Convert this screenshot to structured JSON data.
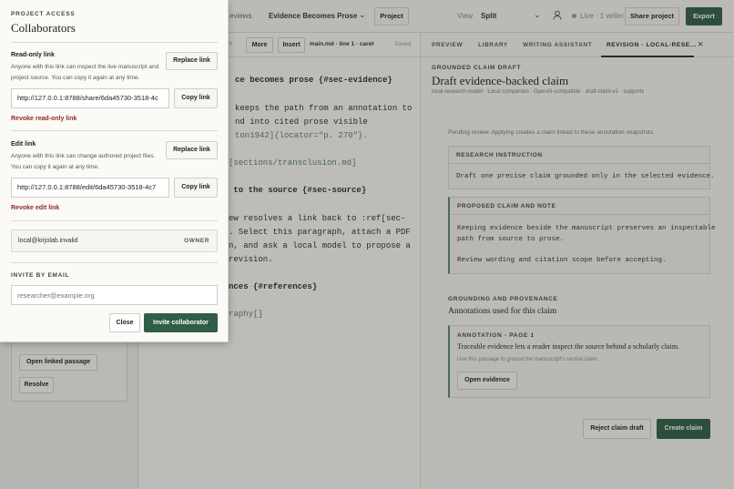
{
  "topbar": {
    "nav_label": "eviews",
    "document_title": "Evidence Becomes Prose",
    "project_button": "Project",
    "view_label": "View",
    "view_value": "Split",
    "live_status": "Live · 1 writer",
    "share_button": "Share project",
    "export_button": "Export"
  },
  "left": {
    "open_linked_passage": "Open linked passage",
    "resolve": "Resolve"
  },
  "editor": {
    "toolbar": {
      "item_partial": "in",
      "more": "More",
      "insert": "Insert",
      "file_status": "main.md · line 1 · caret",
      "saved": "Saved"
    },
    "lines": [
      "ce becomes prose {#sec-evidence}",
      "keeps the path from an annotation to",
      "nd into cited prose visible",
      "ton1942]{locator=\"p. 270\"}.",
      "[sections/transclusion.md]",
      " to the source {#sec-source}",
      "ew resolves a link back to :ref[sec-",
      ". Select this paragraph, attach a PDF",
      "n, and ask a local model to propose a",
      "revision.",
      "nces {#references}",
      "raphy[]"
    ]
  },
  "right": {
    "tabs": [
      "PREVIEW",
      "LIBRARY",
      "WRITING ASSISTANT",
      "REVISION - LOCAL-RESE..."
    ],
    "eyebrow": "GROUNDED CLAIM DRAFT",
    "title": "Draft evidence-backed claim",
    "meta": "local-research-model · Local companion · OpenAI-compatible · draft-claim-v1 · supports",
    "pending": "Pending review. Applying creates a claim linked to these annotation snapshots.",
    "instruction_header": "RESEARCH INSTRUCTION",
    "instruction_text": "Draft one precise claim grounded only in the selected evidence.",
    "proposed_header": "PROPOSED CLAIM AND NOTE",
    "proposed_line1": "Keeping evidence beside the manuscript preserves an inspectable",
    "proposed_line2": "path from source to prose.",
    "proposed_note": "Review wording and citation scope before accepting.",
    "grounding_label": "GROUNDING AND PROVENANCE",
    "grounding_title": "Annotations used for this claim",
    "annotation_header": "ANNOTATION - PAGE 1",
    "annotation_text": "Traceable evidence lets a reader inspect the source behind a scholarly claim.",
    "annotation_sub": "Use this passage to ground the manuscript's central claim.",
    "open_evidence": "Open evidence",
    "reject_button": "Reject claim draft",
    "create_button": "Create claim",
    "close_symbol": "×"
  },
  "modal": {
    "eyebrow": "PROJECT ACCESS",
    "title": "Collaborators",
    "readonly_label": "Read-only link",
    "readonly_help": "Anyone with this link can inspect the live manuscript and project source. You can copy it again at any time.",
    "replace_link": "Replace link",
    "readonly_url": "http://127.0.0.1:8788/share/6da45730-3518-4c",
    "copy_link": "Copy link",
    "revoke_readonly": "Revoke read-only link",
    "edit_label": "Edit link",
    "edit_help": "Anyone with this link can change authored project files. You can copy it again at any time.",
    "edit_url": "http://127.0.0.1:8788/edit/6da45730-3518-4c7",
    "revoke_edit": "Revoke edit link",
    "owner_email": "local@kirjolab.invalid",
    "owner_role": "OWNER",
    "invite_label": "INVITE BY EMAIL",
    "invite_placeholder": "researcher@example.org",
    "close_button": "Close",
    "invite_button": "Invite collaborator"
  }
}
